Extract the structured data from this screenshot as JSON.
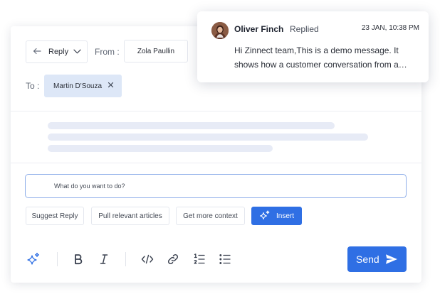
{
  "composer": {
    "reply_button": {
      "label": "Reply",
      "icon": "reply-arrow-icon",
      "chevron": "chevron-down-icon"
    },
    "from": {
      "label": "From :",
      "value": "Zola Paullin"
    },
    "to": {
      "label": "To :",
      "recipient": "Martin D'Souza",
      "remove_icon": "close-icon"
    },
    "ai_prompt": {
      "placeholder": "What do you want to do?"
    },
    "suggestions": [
      {
        "label": "Suggest Reply"
      },
      {
        "label": "Pull relevant articles"
      },
      {
        "label": "Get more context"
      }
    ],
    "insert_button": {
      "label": "Insert",
      "icon": "sparkle-icon"
    },
    "toolbar": {
      "items": [
        "sparkle-icon",
        "bold-icon",
        "italic-icon",
        "code-icon",
        "link-icon",
        "numbered-list-icon",
        "bullet-list-icon"
      ]
    },
    "send_button": {
      "label": "Send",
      "icon": "send-icon"
    }
  },
  "notification": {
    "name": "Oliver Finch",
    "status": "Replied",
    "timestamp": "23 JAN, 10:38 PM",
    "message": "Hi Zinnect team,This is a demo message. It shows how a customer conversation from a customer looks like in the inbox."
  },
  "colors": {
    "accent": "#2f6fe4",
    "chip_bg": "#dde7f7",
    "skeleton": "#e7ebf6",
    "input_border": "#8eaee9"
  }
}
